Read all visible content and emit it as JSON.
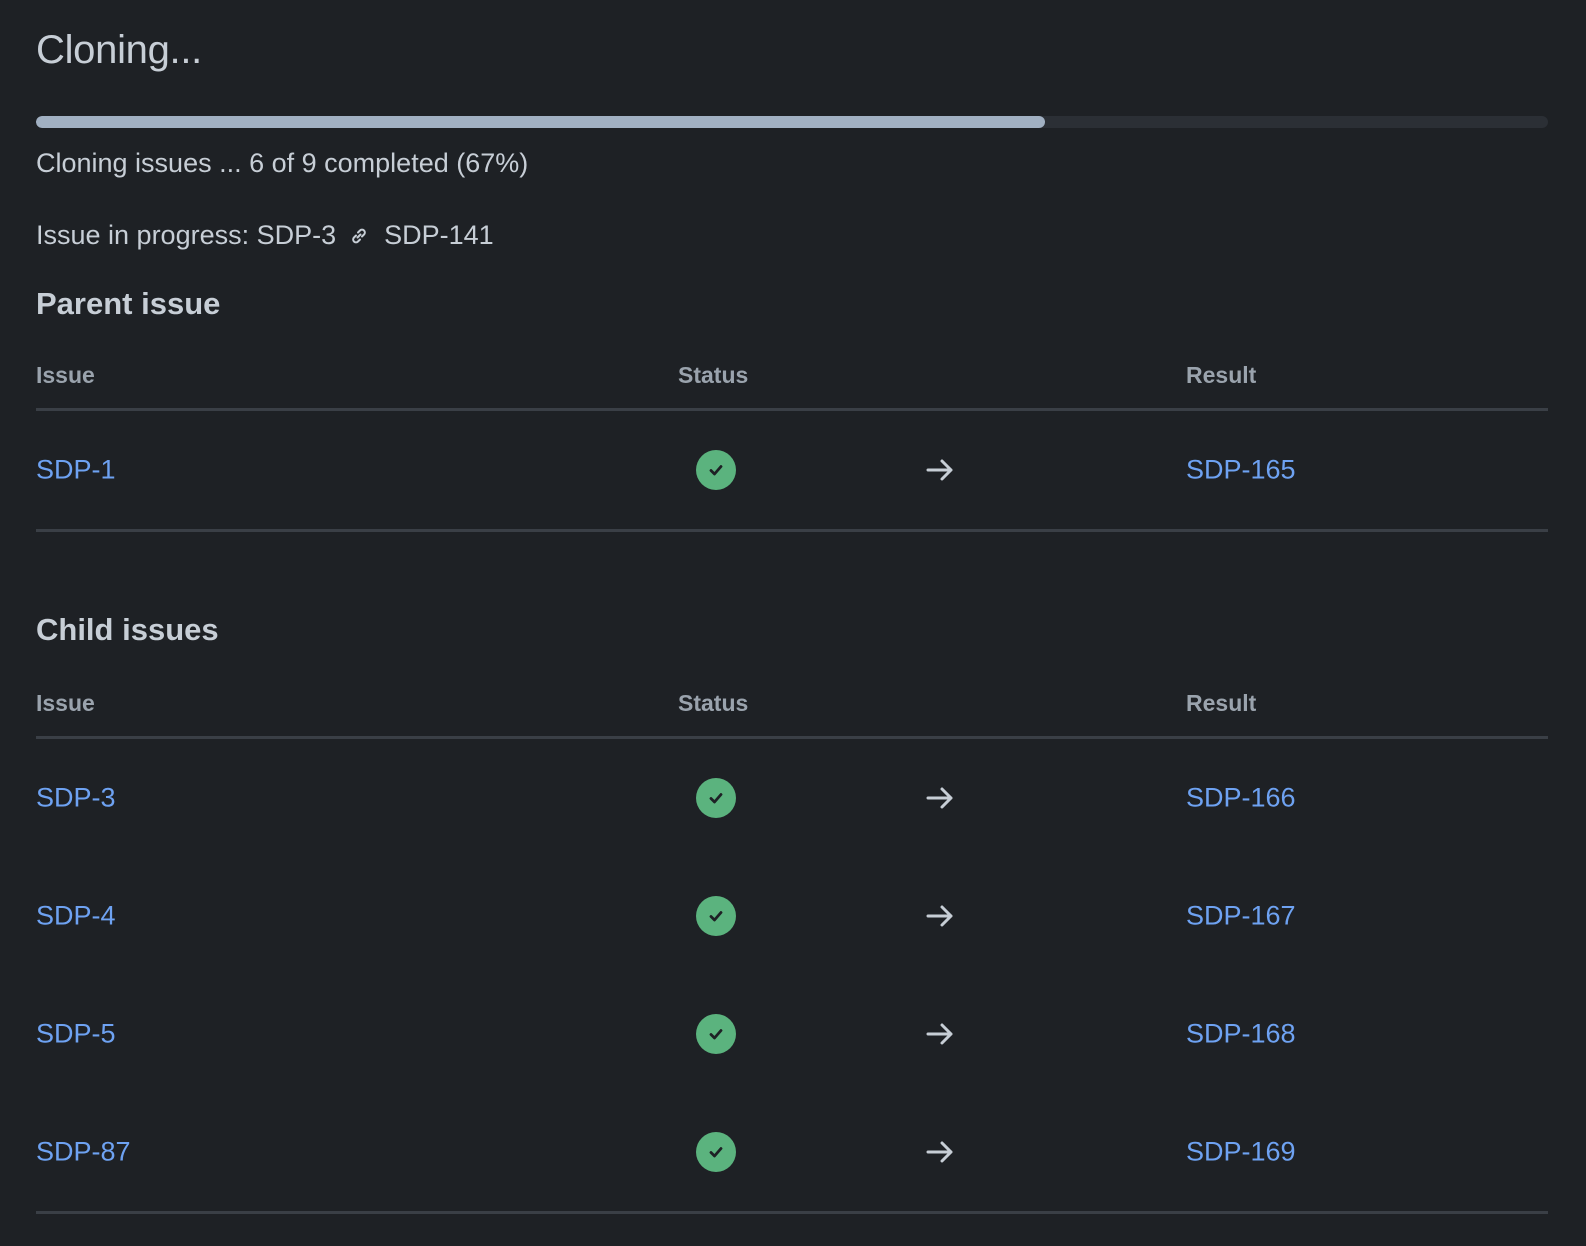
{
  "title": "Cloning...",
  "progress": {
    "fraction": 0.667,
    "text": "Cloning issues ... 6 of 9 completed (67%)"
  },
  "in_progress": {
    "label": "Issue in progress: SDP-3",
    "target": "SDP-141",
    "icon": "link-icon"
  },
  "parent_section": {
    "title": "Parent issue",
    "columns": {
      "issue": "Issue",
      "status": "Status",
      "result": "Result"
    },
    "rows": [
      {
        "issue": "SDP-1",
        "status": "success-check-icon",
        "result": "SDP-165"
      }
    ]
  },
  "child_section": {
    "title": "Child issues",
    "columns": {
      "issue": "Issue",
      "status": "Status",
      "result": "Result"
    },
    "rows": [
      {
        "issue": "SDP-3",
        "status": "success-check-icon",
        "result": "SDP-166"
      },
      {
        "issue": "SDP-4",
        "status": "success-check-icon",
        "result": "SDP-167"
      },
      {
        "issue": "SDP-5",
        "status": "success-check-icon",
        "result": "SDP-168"
      },
      {
        "issue": "SDP-87",
        "status": "success-check-icon",
        "result": "SDP-169"
      }
    ]
  },
  "colors": {
    "background": "#1e2125",
    "link": "#6ea2f2",
    "success": "#5bb37e",
    "progress_fill": "#a1b0c2",
    "progress_track": "#2b2f35"
  }
}
